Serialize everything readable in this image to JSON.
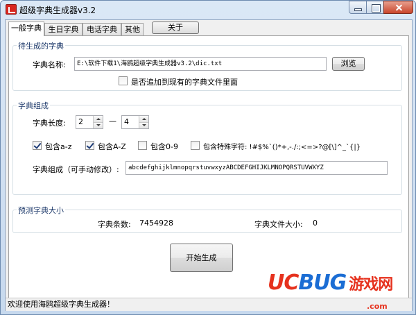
{
  "window": {
    "title": "超级字典生成器v3.2"
  },
  "tabs": [
    {
      "label": "一般字典"
    },
    {
      "label": "生日字典"
    },
    {
      "label": "电话字典"
    },
    {
      "label": "其他"
    }
  ],
  "about_label": "关于",
  "pending_group": {
    "title": "待生成的字典",
    "name_label": "字典名称:",
    "path_value": "E:\\软件下载1\\海鸥超级字典生成器v3.2\\dic.txt",
    "browse_label": "浏览",
    "append_label": "是否追加到现有的字典文件里面",
    "append_checked": false
  },
  "compose_group": {
    "title": "字典组成",
    "length_label": "字典长度:",
    "min_length": "2",
    "dash": "—",
    "max_length": "4",
    "options": [
      {
        "label": "包含a-z",
        "checked": true
      },
      {
        "label": "包含A-Z",
        "checked": true
      },
      {
        "label": "包含0-9",
        "checked": false
      },
      {
        "label": "包含特殊字符: !#$%`()*+,-./:;<=>?@[\\]^_`{|}",
        "checked": false
      }
    ],
    "chars_label": "字典组成（可手动修改）:",
    "chars_value": "abcdefghijklmnopqrstuvwxyzABCDEFGHIJKLMNOPQRSTUVWXYZ"
  },
  "estimate_group": {
    "title": "预测字典大小",
    "count_label": "字典条数:",
    "count_value": "7454928",
    "size_label": "字典文件大小:",
    "size_value": "0"
  },
  "start_label": "开始生成",
  "status_text": "欢迎使用海鸥超级字典生成器！",
  "watermark": {
    "uc": "UC",
    "bug": "BUG",
    "cn": "游戏网",
    "url": ".com"
  }
}
